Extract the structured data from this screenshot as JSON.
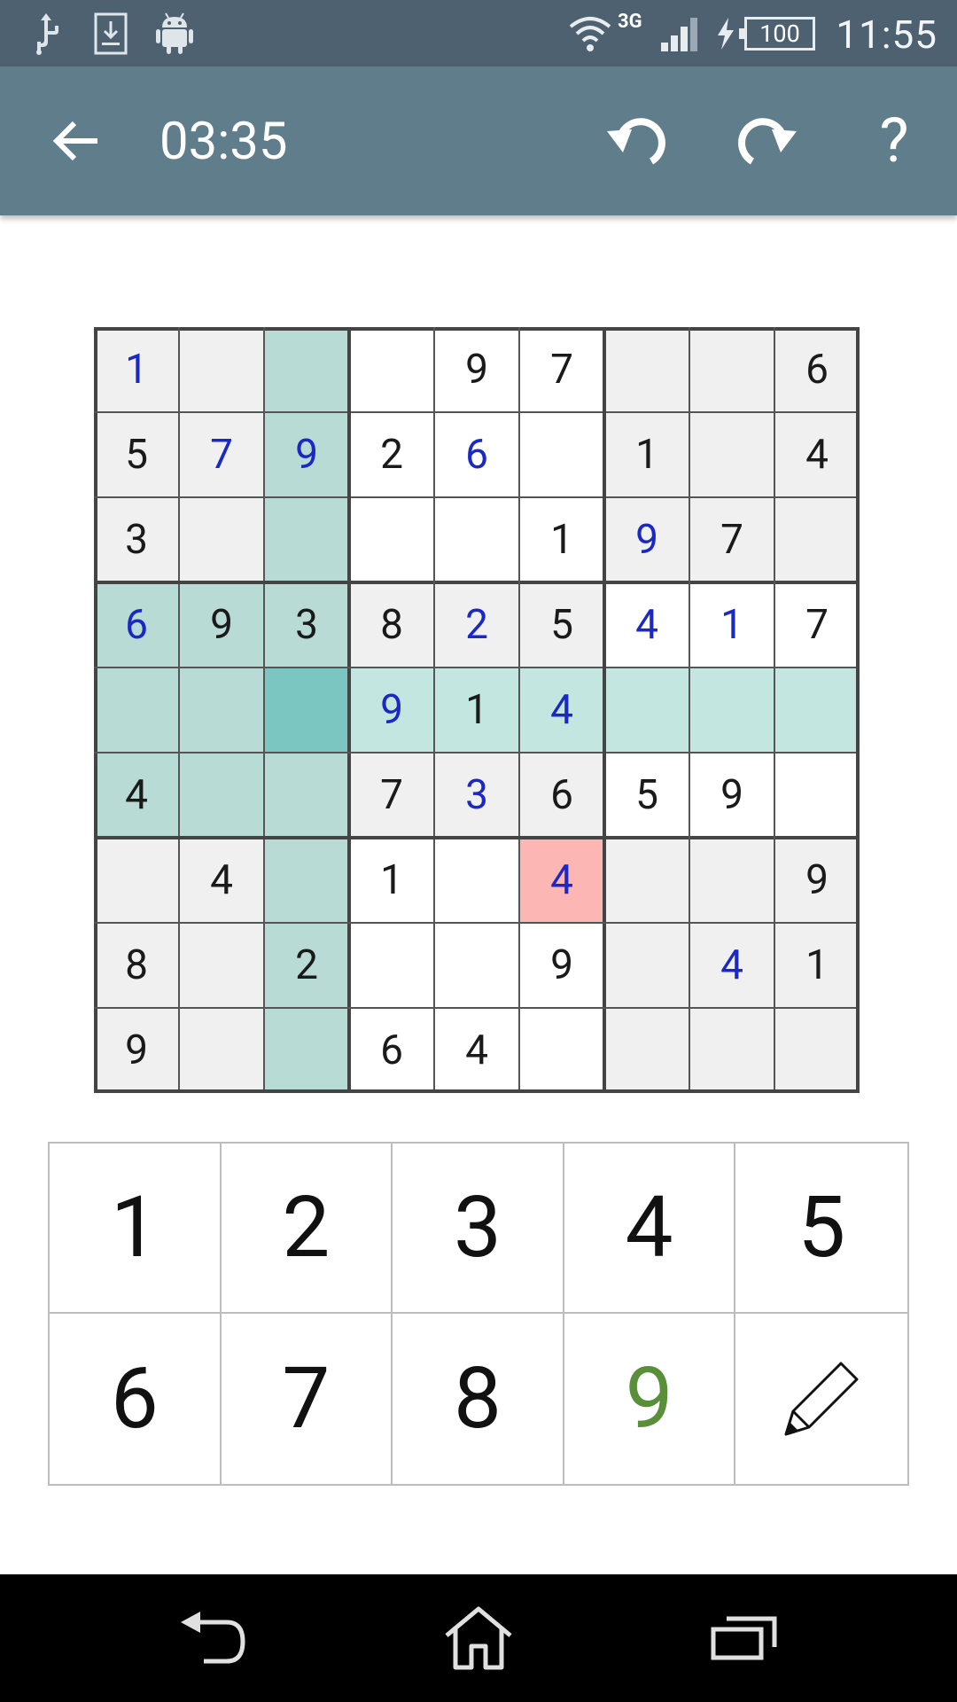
{
  "status_bar": {
    "time": "11:55",
    "network": "3G",
    "battery": "100",
    "icons": [
      "usb-icon",
      "download-icon",
      "android-icon",
      "wifi-icon",
      "signal-icon",
      "charging-icon",
      "battery-icon"
    ]
  },
  "app_bar": {
    "timer": "03:35",
    "help_label": "?",
    "icons": [
      "back-arrow-icon",
      "undo-icon",
      "redo-icon",
      "help-icon"
    ]
  },
  "board": {
    "rows": [
      [
        "1",
        "",
        "",
        "",
        "9",
        "7",
        "",
        "",
        "6"
      ],
      [
        "5",
        "7",
        "9",
        "2",
        "6",
        "",
        "1",
        "",
        "4"
      ],
      [
        "3",
        "",
        "",
        "",
        "",
        "1",
        "9",
        "7",
        ""
      ],
      [
        "6",
        "9",
        "3",
        "8",
        "2",
        "5",
        "4",
        "1",
        "7"
      ],
      [
        "",
        "",
        "",
        "9",
        "1",
        "4",
        "",
        "",
        ""
      ],
      [
        "4",
        "",
        "",
        "7",
        "3",
        "6",
        "5",
        "9",
        ""
      ],
      [
        "",
        "4",
        "",
        "1",
        "",
        "4",
        "",
        "",
        "9"
      ],
      [
        "8",
        "",
        "2",
        "",
        "",
        "9",
        "",
        "4",
        "1"
      ],
      [
        "9",
        "",
        "",
        "6",
        "4",
        "",
        "",
        "",
        ""
      ]
    ],
    "user_entries": [
      [
        0,
        0
      ],
      [
        1,
        1
      ],
      [
        1,
        2
      ],
      [
        1,
        4
      ],
      [
        3,
        0
      ],
      [
        3,
        4
      ],
      [
        3,
        6
      ],
      [
        3,
        7
      ],
      [
        4,
        3
      ],
      [
        4,
        5
      ],
      [
        5,
        4
      ],
      [
        6,
        5
      ],
      [
        7,
        7
      ],
      [
        2,
        6
      ]
    ],
    "selected_cell": [
      4,
      2
    ],
    "conflict_cell": [
      6,
      5
    ],
    "colors": {
      "given": "#1a1a1a",
      "user": "#1a28c8",
      "box_shade": "#f0f0f0",
      "peer_highlight": "#c3e6e1",
      "block_highlight": "#b8dbd6",
      "selected": "#7bc6c0",
      "conflict": "#fcb7b4"
    }
  },
  "keypad": {
    "keys": [
      "1",
      "2",
      "3",
      "4",
      "5",
      "6",
      "7",
      "8",
      "9"
    ],
    "highlighted_key": "9",
    "highlight_color": "#5a8f3a",
    "pencil_icon": "pencil-icon"
  },
  "nav_bar": {
    "icons": [
      "nav-back-icon",
      "nav-home-icon",
      "nav-recents-icon"
    ]
  }
}
